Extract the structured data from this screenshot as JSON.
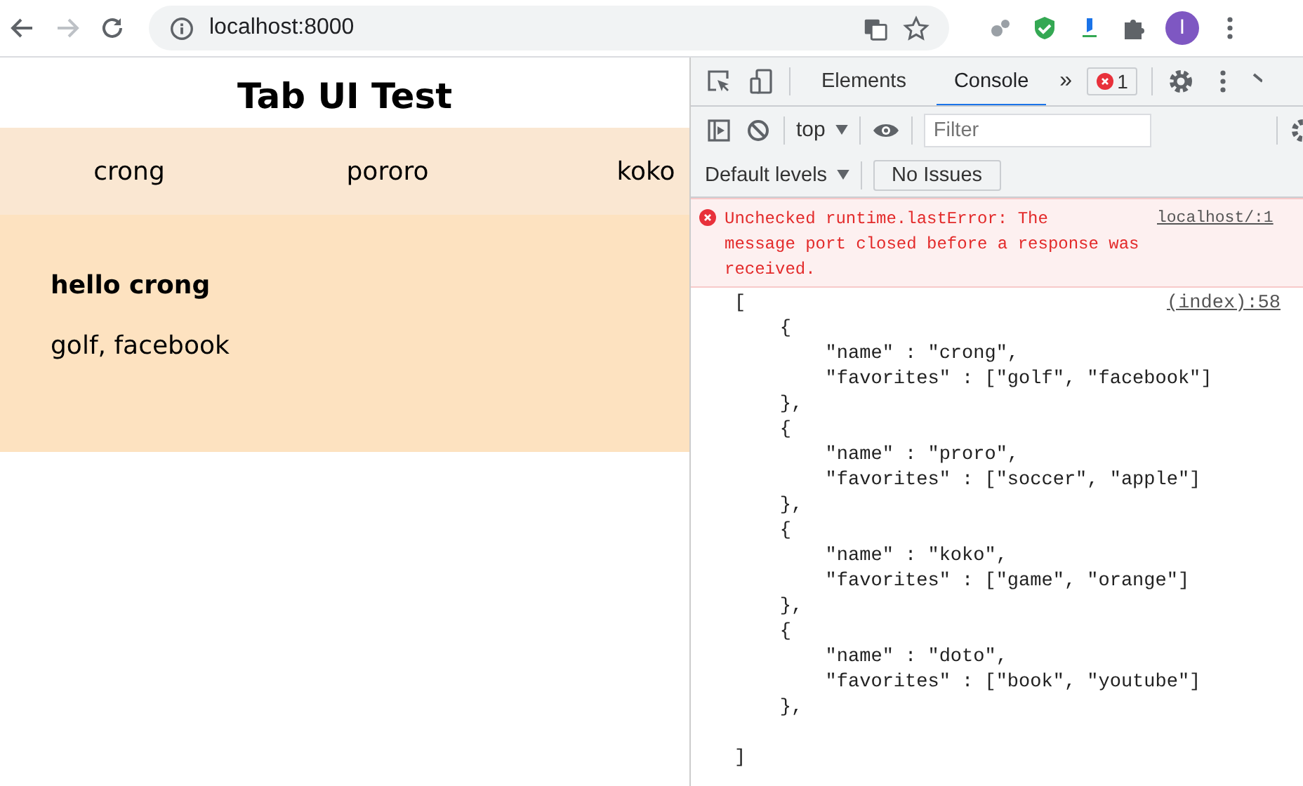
{
  "browser": {
    "address": "localhost:8000",
    "avatar": "I"
  },
  "page": {
    "title": "Tab UI Test",
    "tabs": [
      {
        "label": "crong"
      },
      {
        "label": "pororo"
      },
      {
        "label": "koko"
      }
    ],
    "content": {
      "heading": "hello crong",
      "text": "golf, facebook"
    }
  },
  "devtools": {
    "tabs": [
      {
        "label": "Elements",
        "selected": false
      },
      {
        "label": "Console",
        "selected": true
      }
    ],
    "more": "»",
    "error_count": "1",
    "context": "top",
    "filter": {
      "placeholder": "Filter"
    },
    "levels": "Default levels",
    "issues": "No Issues",
    "error": {
      "message": "Unchecked runtime.lastError: The message port closed before a response was received.",
      "source": "localhost/:1"
    },
    "log": {
      "source": "(index):58",
      "lines": [
        "[",
        "    {",
        "        \"name\" : \"crong\",",
        "        \"favorites\" : [\"golf\", \"facebook\"]",
        "    },",
        "    {",
        "        \"name\" : \"proro\",",
        "        \"favorites\" : [\"soccer\", \"apple\"]",
        "    },",
        "    {",
        "        \"name\" : \"koko\",",
        "        \"favorites\" : [\"game\", \"orange\"]",
        "    },",
        "    {",
        "        \"name\" : \"doto\",",
        "        \"favorites\" : [\"book\", \"youtube\"]",
        "    },",
        "]"
      ]
    }
  }
}
